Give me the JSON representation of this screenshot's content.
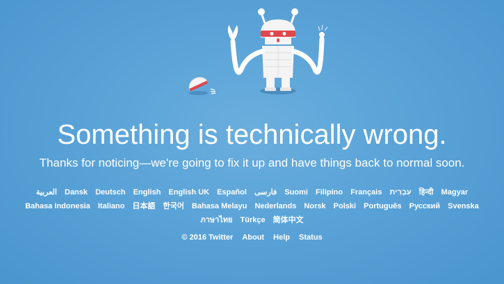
{
  "error": {
    "title": "Something is technically wrong.",
    "message": "Thanks for noticing—we're going to fix it up and have things back to normal soon."
  },
  "languages": [
    "العربية",
    "Dansk",
    "Deutsch",
    "English",
    "English UK",
    "Español",
    "فارسی",
    "Suomi",
    "Filipino",
    "Français",
    "עִבְרִית",
    "हिन्दी",
    "Magyar",
    "Bahasa Indonesia",
    "Italiano",
    "日本語",
    "한국어",
    "Bahasa Melayu",
    "Nederlands",
    "Norsk",
    "Polski",
    "Português",
    "Русский",
    "Svenska",
    "ภาษาไทย",
    "Türkçe",
    "简体中文"
  ],
  "footer": {
    "copyright": "© 2016 Twitter",
    "about": "About",
    "help": "Help",
    "status": "Status"
  },
  "illustration": {
    "name": "robot-icon",
    "background_color": "#5aa3d8",
    "visor_color": "#e0474c"
  }
}
